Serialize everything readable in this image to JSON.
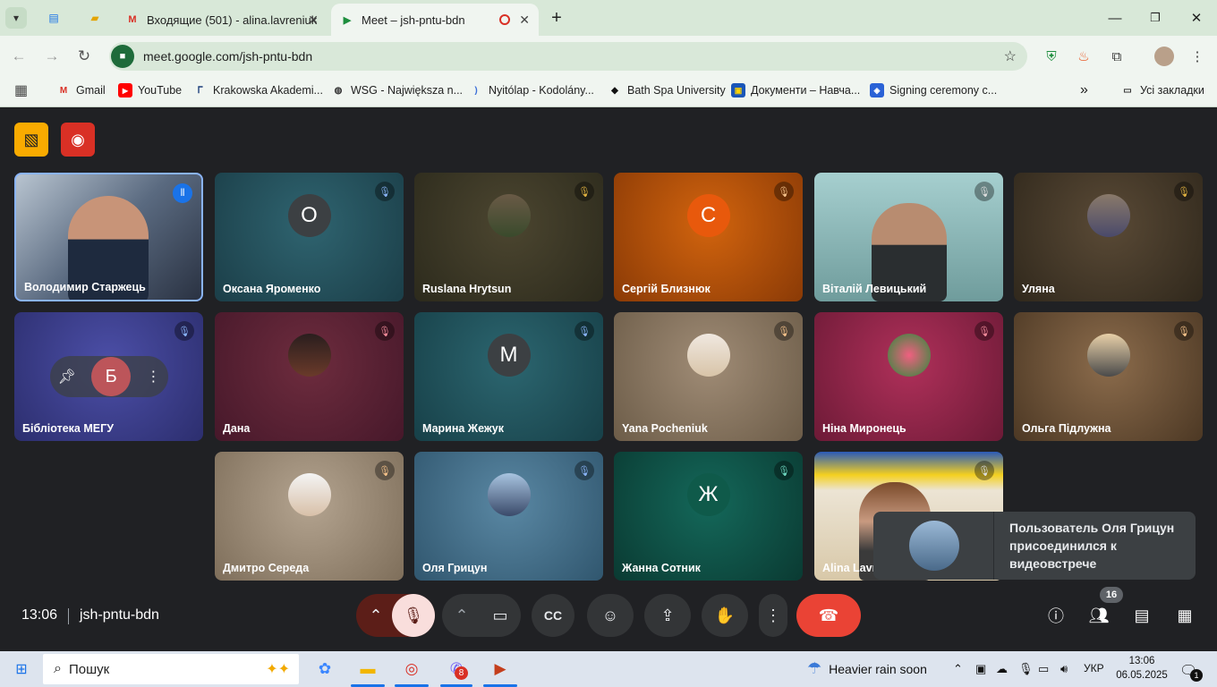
{
  "browser": {
    "tabs": [
      {
        "title": "Входящие (501) - alina.lavreniuk",
        "favicon": "gmail-icon"
      },
      {
        "title": "Meet – jsh-pntu-bdn",
        "favicon": "meet-icon"
      }
    ],
    "url": "meet.google.com/jsh-pntu-bdn",
    "bookmarks": [
      {
        "label": "Gmail"
      },
      {
        "label": "YouTube"
      },
      {
        "label": "Krakowska Akademi..."
      },
      {
        "label": "WSG - Największa n..."
      },
      {
        "label": "Nyitólap - Kodolány..."
      },
      {
        "label": "Bath Spa University"
      },
      {
        "label": "Документи – Навча..."
      },
      {
        "label": "Signing ceremony c..."
      }
    ],
    "all_bookmarks": "Усі закладки"
  },
  "meet": {
    "participants": [
      {
        "name": "Володимир Старжець",
        "initial": "",
        "bg": "#6c7e96"
      },
      {
        "name": "Оксана Яроменко",
        "initial": "O",
        "bg": "#245460"
      },
      {
        "name": "Ruslana Hrytsun",
        "initial": "",
        "bg": "#3a3624"
      },
      {
        "name": "Сергій Близнюк",
        "initial": "С",
        "bg": "#b9540c"
      },
      {
        "name": "Віталій Левицький",
        "initial": "",
        "bg": "#8ab3b3"
      },
      {
        "name": "Уляна",
        "initial": "",
        "bg": "#4a3d2c"
      },
      {
        "name": "Бібліотека МЕГУ",
        "initial": "Б",
        "bg": "#3b3e8e"
      },
      {
        "name": "Дана",
        "initial": "",
        "bg": "#5a2432"
      },
      {
        "name": "Марина Жежук",
        "initial": "M",
        "bg": "#22535c"
      },
      {
        "name": "Yana Pocheniuk",
        "initial": "",
        "bg": "#8c7860"
      },
      {
        "name": "Ніна Миронець",
        "initial": "",
        "bg": "#8c2348"
      },
      {
        "name": "Ольга Підлужна",
        "initial": "",
        "bg": "#705236"
      },
      {
        "name": "Дмитро Середа",
        "initial": "",
        "bg": "#9a8a76"
      },
      {
        "name": "Оля Грицун",
        "initial": "",
        "bg": "#46738e"
      },
      {
        "name": "Жанна Сотник",
        "initial": "Ж",
        "bg": "#0e4a40"
      },
      {
        "name": "Alina Lavr",
        "initial": "",
        "bg": "#d8c8a8"
      }
    ],
    "toast": "Пользователь Оля Грицун присоединился к видеовстрече",
    "time": "13:06",
    "meeting_code": "jsh-pntu-bdn",
    "participant_count": "16"
  },
  "taskbar": {
    "search_placeholder": "Пошук",
    "weather": "Heavier rain soon",
    "language": "УКР",
    "clock_time": "13:06",
    "clock_date": "06.05.2025",
    "viber_badge": "8",
    "notification_badge": "1"
  }
}
